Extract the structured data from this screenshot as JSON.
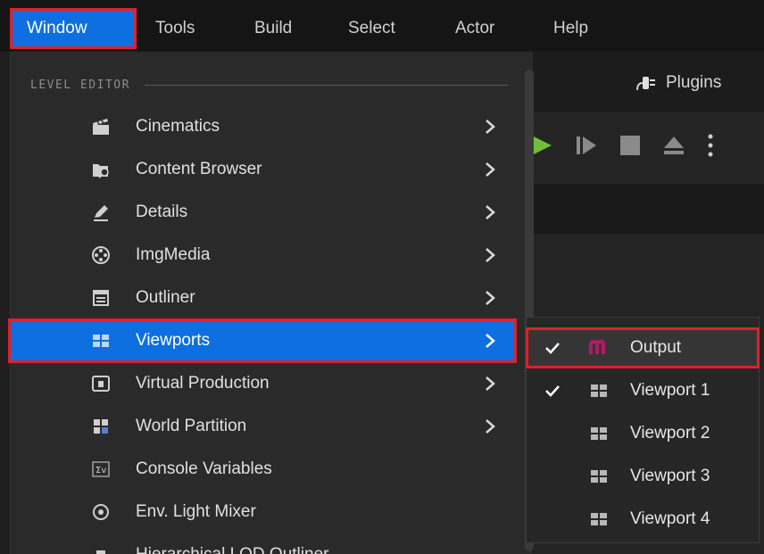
{
  "menubar": {
    "items": [
      {
        "label": "Window",
        "active": true
      },
      {
        "label": "Tools"
      },
      {
        "label": "Build"
      },
      {
        "label": "Select"
      },
      {
        "label": "Actor"
      },
      {
        "label": "Help"
      }
    ]
  },
  "background": {
    "plugins_label": "Plugins",
    "play_color": "#6fbf3a"
  },
  "window_menu": {
    "section_title": "LEVEL EDITOR",
    "items": [
      {
        "label": "Cinematics",
        "icon": "clapperboard-icon",
        "submenu": true
      },
      {
        "label": "Content Browser",
        "icon": "folder-search-icon",
        "submenu": true
      },
      {
        "label": "Details",
        "icon": "pencil-icon",
        "submenu": true
      },
      {
        "label": "ImgMedia",
        "icon": "film-reel-icon",
        "submenu": true
      },
      {
        "label": "Outliner",
        "icon": "outliner-list-icon",
        "submenu": true
      },
      {
        "label": "Viewports",
        "icon": "viewport-grid-icon",
        "submenu": true,
        "selected": true
      },
      {
        "label": "Virtual Production",
        "icon": "virtual-production-icon",
        "submenu": true
      },
      {
        "label": "World Partition",
        "icon": "world-partition-icon",
        "submenu": true
      },
      {
        "label": "Console Variables",
        "icon": "console-variables-icon",
        "submenu": false
      },
      {
        "label": "Env. Light Mixer",
        "icon": "light-mixer-icon",
        "submenu": false
      },
      {
        "label": "Hierarchical LOD Outliner",
        "icon": "hlod-icon",
        "submenu": false
      }
    ]
  },
  "viewports_submenu": {
    "items": [
      {
        "label": "Output",
        "checked": true,
        "icon": "media-output-icon",
        "highlight": true
      },
      {
        "label": "Viewport 1",
        "checked": true,
        "icon": "viewport-grid-icon"
      },
      {
        "label": "Viewport 2",
        "checked": false,
        "icon": "viewport-grid-icon"
      },
      {
        "label": "Viewport 3",
        "checked": false,
        "icon": "viewport-grid-icon"
      },
      {
        "label": "Viewport 4",
        "checked": false,
        "icon": "viewport-grid-icon"
      }
    ]
  },
  "colors": {
    "accent": "#0d6fe0",
    "highlight_outline": "#e0202a",
    "output_icon": "#b01a6a"
  }
}
